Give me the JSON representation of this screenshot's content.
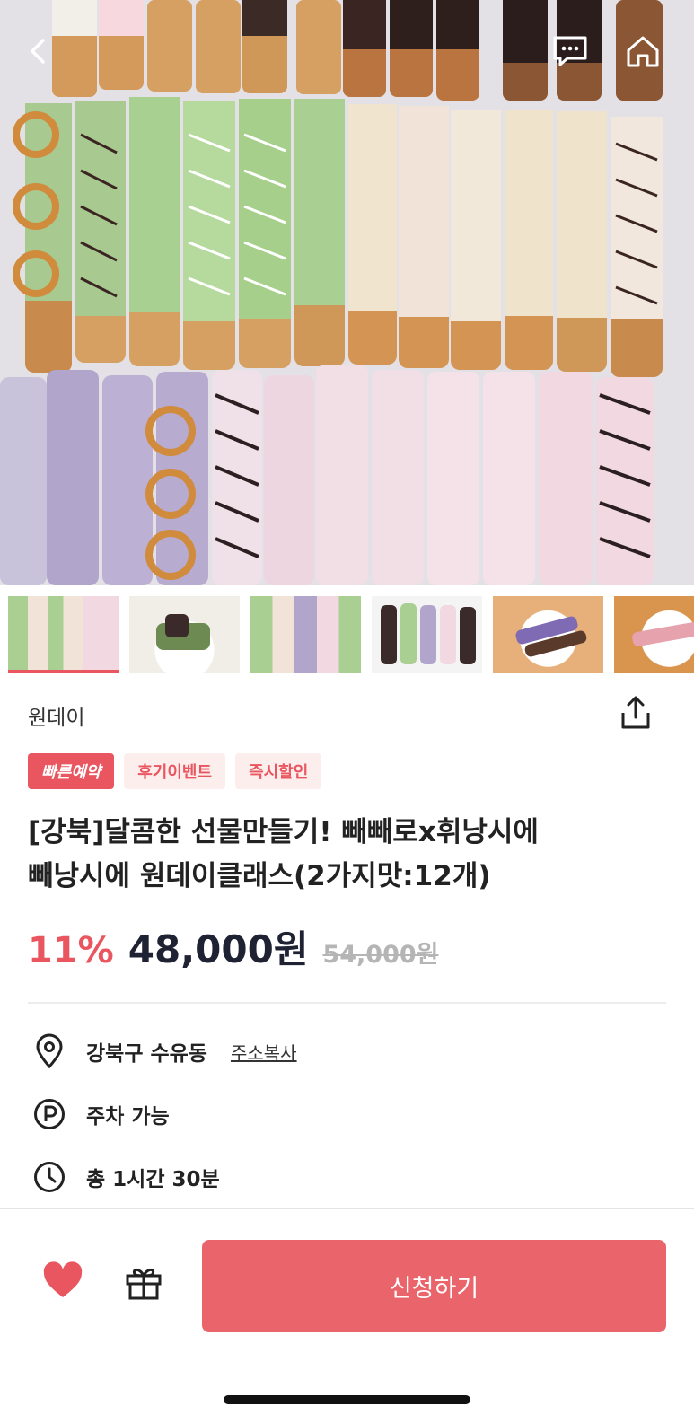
{
  "header": {
    "back_icon": "chevron-left-icon",
    "chat_icon": "chat-bubble-icon",
    "home_icon": "home-icon"
  },
  "gallery": {
    "thumbnails": [
      "thumb-1",
      "thumb-2",
      "thumb-3",
      "thumb-4",
      "thumb-5",
      "thumb-6"
    ],
    "active_index": 0
  },
  "product": {
    "brand": "원데이",
    "tags": [
      "빠른예약",
      "후기이벤트",
      "즉시할인"
    ],
    "title_line1": "[강북]달콤한 선물만들기! 빼빼로x휘낭시에",
    "title_line2": "빼낭시에 원데이클래스(2가지맛:12개)",
    "discount": "11%",
    "price": "48,000원",
    "original_price": "54,000원"
  },
  "info": {
    "location": "강북구 수유동",
    "copy_address": "주소복사",
    "parking": "주차 가능",
    "duration": "총 1시간 30분"
  },
  "actions": {
    "apply_label": "신청하기"
  },
  "colors": {
    "accent": "#e9565f",
    "apply_button": "#e9656b",
    "price_text": "#1f2233"
  }
}
